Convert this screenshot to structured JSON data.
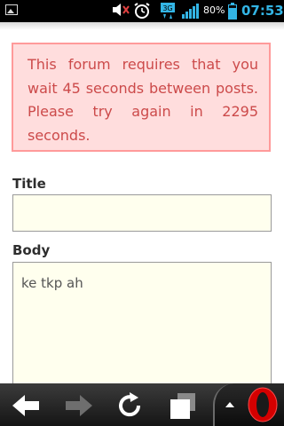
{
  "status_bar": {
    "battery_percent": "80%",
    "time": "07:53",
    "network_label": "3G",
    "accent_color": "#33b5e5",
    "icons": [
      "gallery-icon",
      "speaker-muted-icon",
      "alarm-icon",
      "network-3g-icon",
      "signal-icon",
      "battery-icon"
    ]
  },
  "error": {
    "message": "This forum requires that you wait 45 seconds between posts. Please try again in 2295 seconds."
  },
  "form": {
    "title_label": "Title",
    "title_value": "",
    "body_label": "Body",
    "body_value": "ke tkp ah"
  },
  "toolbar": {
    "buttons": [
      "back-icon",
      "forward-icon",
      "reload-icon",
      "tabs-icon",
      "opera-menu-icon"
    ]
  },
  "colors": {
    "error_bg": "#ffdddd",
    "error_border": "#ff9a9a",
    "error_text": "#cc4a4a",
    "input_bg": "#ffffee"
  }
}
